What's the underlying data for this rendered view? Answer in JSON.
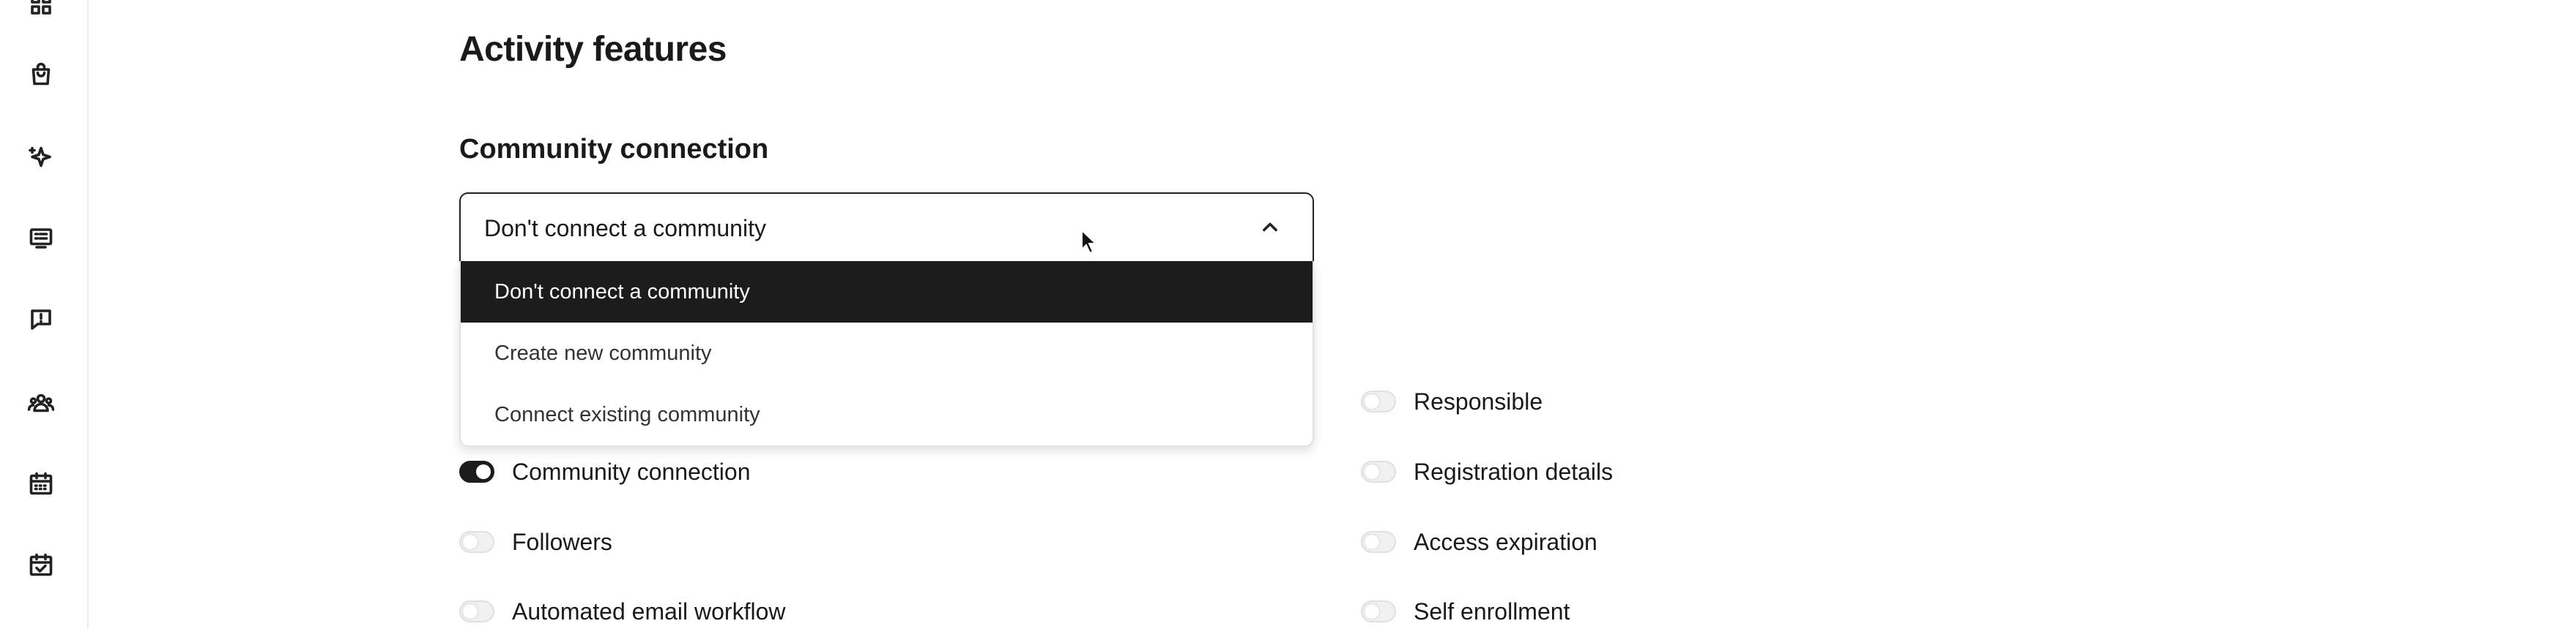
{
  "sidebar": {
    "icons": [
      {
        "name": "dashboard-icon"
      },
      {
        "name": "shopping-bag-icon"
      },
      {
        "name": "sparkles-icon"
      },
      {
        "name": "list-icon"
      },
      {
        "name": "alert-message-icon"
      },
      {
        "name": "people-group-icon"
      },
      {
        "name": "calendar-icon"
      },
      {
        "name": "calendar-check-icon"
      }
    ]
  },
  "page": {
    "title": "Activity features"
  },
  "community": {
    "section_title": "Community connection",
    "selected": "Don't connect a community",
    "options": [
      "Don't connect a community",
      "Create new community",
      "Connect existing community"
    ]
  },
  "features": {
    "left": [
      {
        "label": "Community connection",
        "enabled": true
      },
      {
        "label": "Followers",
        "enabled": false
      },
      {
        "label": "Automated email workflow",
        "enabled": false
      }
    ],
    "right": [
      {
        "label": "Responsible",
        "enabled": false
      },
      {
        "label": "Registration details",
        "enabled": false
      },
      {
        "label": "Access expiration",
        "enabled": false
      },
      {
        "label": "Self enrollment",
        "enabled": false
      }
    ]
  },
  "colors": {
    "accent": "#1c1c1c",
    "toggle_off": "#f1f1f1"
  }
}
